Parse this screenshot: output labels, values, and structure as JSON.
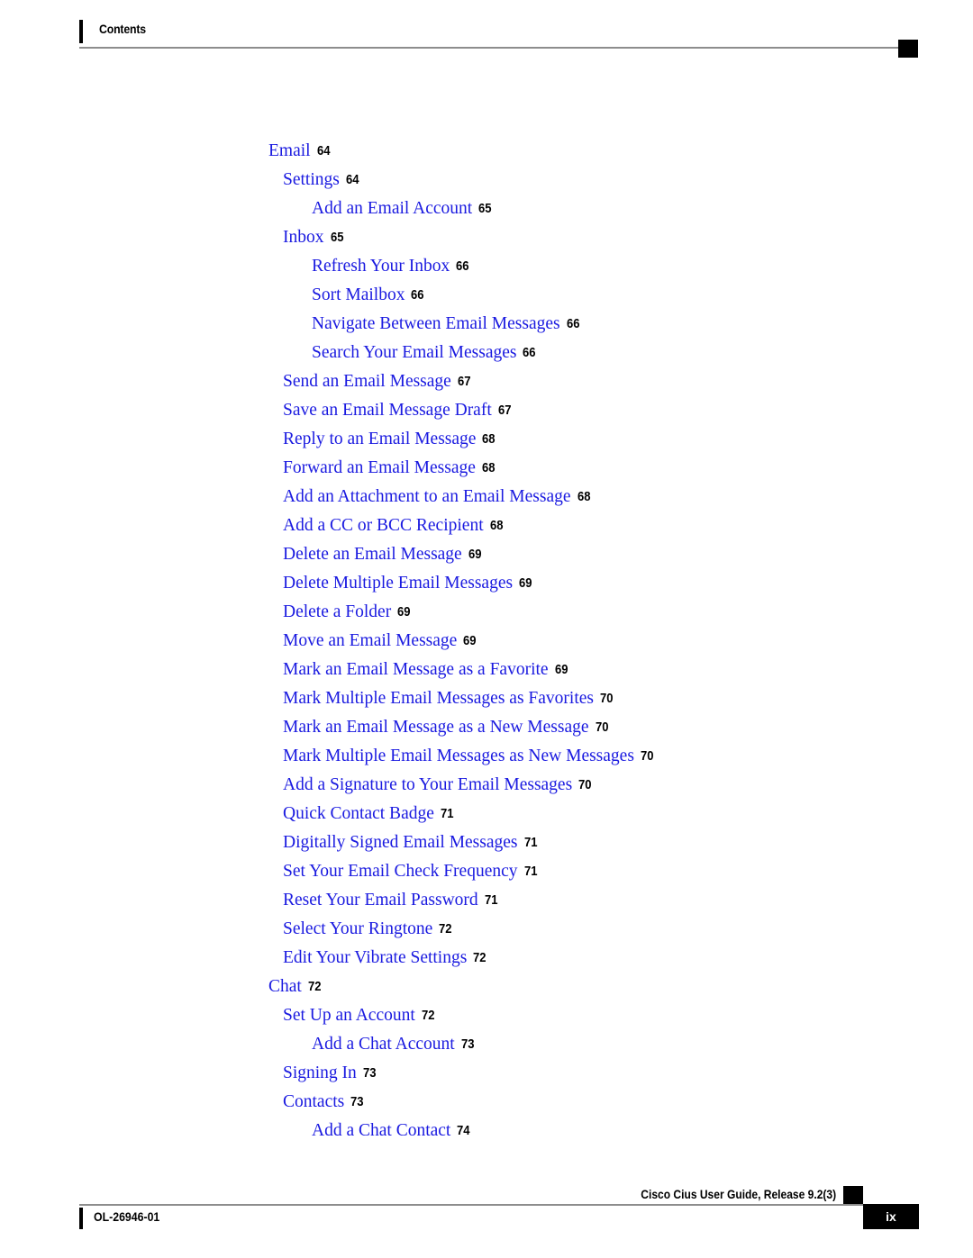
{
  "header": {
    "title": "Contents"
  },
  "colors": {
    "link": "#1a1ae0",
    "text": "#000000",
    "rule": "#8d8d8d"
  },
  "toc": {
    "entries": [
      {
        "level": 1,
        "title": "Email",
        "page": "64"
      },
      {
        "level": 2,
        "title": "Settings",
        "page": "64"
      },
      {
        "level": 3,
        "title": "Add an Email Account",
        "page": "65"
      },
      {
        "level": 2,
        "title": "Inbox",
        "page": "65"
      },
      {
        "level": 3,
        "title": "Refresh Your Inbox",
        "page": "66"
      },
      {
        "level": 3,
        "title": "Sort Mailbox",
        "page": "66"
      },
      {
        "level": 3,
        "title": "Navigate Between Email Messages",
        "page": "66"
      },
      {
        "level": 3,
        "title": "Search Your Email Messages",
        "page": "66"
      },
      {
        "level": 2,
        "title": "Send an Email Message",
        "page": "67"
      },
      {
        "level": 2,
        "title": "Save an Email Message Draft",
        "page": "67"
      },
      {
        "level": 2,
        "title": "Reply to an Email Message",
        "page": "68"
      },
      {
        "level": 2,
        "title": "Forward an Email Message",
        "page": "68"
      },
      {
        "level": 2,
        "title": "Add an Attachment to an Email Message",
        "page": "68"
      },
      {
        "level": 2,
        "title": "Add a CC or BCC Recipient",
        "page": "68"
      },
      {
        "level": 2,
        "title": "Delete an Email Message",
        "page": "69"
      },
      {
        "level": 2,
        "title": "Delete Multiple Email Messages",
        "page": "69"
      },
      {
        "level": 2,
        "title": "Delete a Folder",
        "page": "69"
      },
      {
        "level": 2,
        "title": "Move an Email Message",
        "page": "69"
      },
      {
        "level": 2,
        "title": "Mark an Email Message as a Favorite",
        "page": "69"
      },
      {
        "level": 2,
        "title": "Mark Multiple Email Messages as Favorites",
        "page": "70"
      },
      {
        "level": 2,
        "title": "Mark an Email Message as a New Message",
        "page": "70"
      },
      {
        "level": 2,
        "title": "Mark Multiple Email Messages as New Messages",
        "page": "70"
      },
      {
        "level": 2,
        "title": "Add a Signature to Your Email Messages",
        "page": "70"
      },
      {
        "level": 2,
        "title": "Quick Contact Badge",
        "page": "71"
      },
      {
        "level": 2,
        "title": "Digitally Signed Email Messages",
        "page": "71"
      },
      {
        "level": 2,
        "title": "Set Your Email Check Frequency",
        "page": "71"
      },
      {
        "level": 2,
        "title": "Reset Your Email Password",
        "page": "71"
      },
      {
        "level": 2,
        "title": "Select Your Ringtone",
        "page": "72"
      },
      {
        "level": 2,
        "title": "Edit Your Vibrate Settings",
        "page": "72"
      },
      {
        "level": 1,
        "title": "Chat",
        "page": "72"
      },
      {
        "level": 2,
        "title": "Set Up an Account",
        "page": "72"
      },
      {
        "level": 3,
        "title": "Add a Chat Account",
        "page": "73"
      },
      {
        "level": 2,
        "title": "Signing In",
        "page": "73"
      },
      {
        "level": 2,
        "title": "Contacts",
        "page": "73"
      },
      {
        "level": 3,
        "title": "Add a Chat Contact",
        "page": "74"
      }
    ]
  },
  "footer": {
    "document_id": "OL-26946-01",
    "document_title": "Cisco Cius User Guide, Release 9.2(3)",
    "page_number": "ix"
  }
}
